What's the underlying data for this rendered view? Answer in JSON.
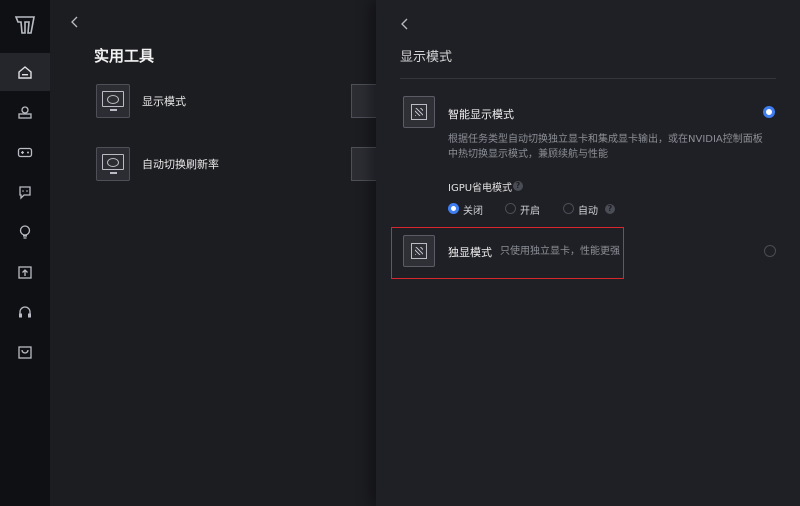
{
  "main": {
    "title": "实用工具",
    "tools": [
      {
        "label": "显示模式",
        "icon": "display-mode-icon"
      },
      {
        "label": "自动切换刷新率",
        "icon": "refresh-rate-icon"
      }
    ]
  },
  "panel": {
    "title": "显示模式",
    "smart": {
      "title": "智能显示模式",
      "desc_line1": "根据任务类型自动切换独立显卡和集成显卡输出，或在NVIDIA控制面板",
      "desc_line2": "中热切换显示模式，兼顾续航与性能",
      "selected": true
    },
    "igpu": {
      "title": "IGPU省电模式",
      "options": [
        {
          "label": "关闭",
          "selected": true
        },
        {
          "label": "开启",
          "selected": false
        },
        {
          "label": "自动",
          "selected": false
        }
      ]
    },
    "discrete": {
      "title": "独显模式",
      "desc": "只使用独立显卡，性能更强",
      "selected": false
    }
  },
  "colors": {
    "accent": "#3f7ef0",
    "highlight": "#d8262c"
  }
}
